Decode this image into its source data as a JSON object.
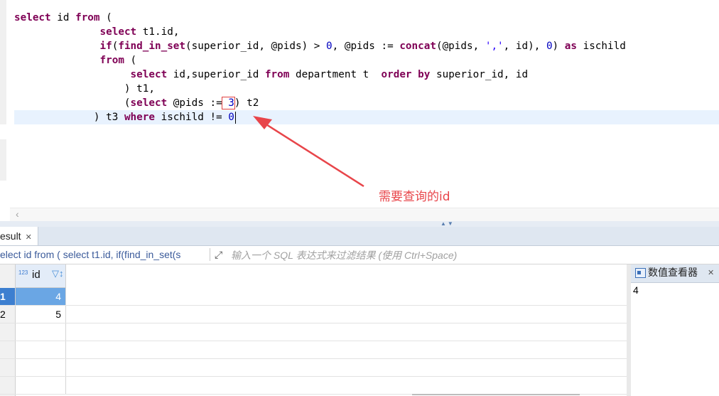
{
  "editor": {
    "lines": [
      {
        "parts": [
          [
            "kw",
            "select"
          ],
          [
            "t",
            " id "
          ],
          [
            "kw",
            "from"
          ],
          [
            "t",
            " ("
          ]
        ]
      },
      {
        "parts": [
          [
            "t",
            "              "
          ],
          [
            "kw",
            "select"
          ],
          [
            "t",
            " t1.id,"
          ]
        ]
      },
      {
        "parts": [
          [
            "t",
            "              "
          ],
          [
            "kw",
            "if"
          ],
          [
            "t",
            "("
          ],
          [
            "kw",
            "find_in_set"
          ],
          [
            "t",
            "(superior_id, @pids) > "
          ],
          [
            "num",
            "0"
          ],
          [
            "t",
            ", @pids := "
          ],
          [
            "kw",
            "concat"
          ],
          [
            "t",
            "(@pids, "
          ],
          [
            "str",
            "','"
          ],
          [
            "t",
            ", id), "
          ],
          [
            "num",
            "0"
          ],
          [
            "t",
            ") "
          ],
          [
            "kw",
            "as"
          ],
          [
            "t",
            " ischild"
          ]
        ]
      },
      {
        "parts": [
          [
            "t",
            "              "
          ],
          [
            "kw",
            "from"
          ],
          [
            "t",
            " ("
          ]
        ]
      },
      {
        "parts": [
          [
            "t",
            "                   "
          ],
          [
            "kw",
            "select"
          ],
          [
            "t",
            " id,superior_id "
          ],
          [
            "kw",
            "from"
          ],
          [
            "t",
            " department t  "
          ],
          [
            "kw",
            "order by"
          ],
          [
            "t",
            " superior_id, id"
          ]
        ]
      },
      {
        "parts": [
          [
            "t",
            "                  ) t1,"
          ]
        ]
      },
      {
        "parts": [
          [
            "t",
            "                  ("
          ],
          [
            "kw",
            "select"
          ],
          [
            "t",
            " @pids :="
          ],
          [
            "box",
            " 3"
          ],
          [
            "t",
            ") t2"
          ]
        ]
      },
      {
        "parts": [
          [
            "t",
            "             ) t3 "
          ],
          [
            "kw",
            "where"
          ],
          [
            "t",
            " ischild != "
          ],
          [
            "num",
            "0"
          ],
          [
            "caret",
            ""
          ]
        ]
      }
    ],
    "annotation": "需要查询的id"
  },
  "result": {
    "tab_label": "esult",
    "filter_query": "elect id from ( select t1.id, if(find_in_set(s",
    "filter_placeholder": "输入一个 SQL 表达式来过滤结果 (使用 Ctrl+Space)",
    "column": {
      "type_badge": "123",
      "name": "id",
      "sort_icon": "filter-sort-icon"
    },
    "rows": [
      {
        "num": "1",
        "id": "4"
      },
      {
        "num": "2",
        "id": "5"
      }
    ]
  },
  "viewer": {
    "title": "数值查看器",
    "value": "4"
  },
  "colors": {
    "keyword": "#7f0055",
    "number": "#0000c0",
    "annotation": "#e8454a",
    "selection": "#6aa6e4"
  }
}
